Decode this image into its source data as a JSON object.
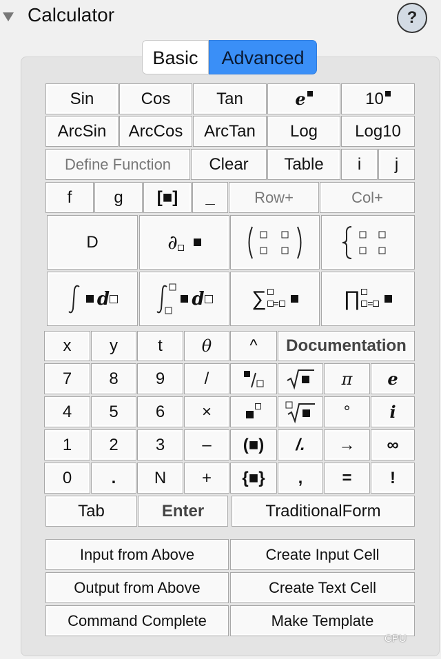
{
  "header": {
    "title": "Calculator",
    "help_label": "?"
  },
  "tabs": {
    "basic": "Basic",
    "advanced": "Advanced"
  },
  "trig": {
    "sin": "Sin",
    "cos": "Cos",
    "tan": "Tan",
    "exp_base": "e",
    "pow10_base": "10",
    "arcsin": "ArcSin",
    "arccos": "ArcCos",
    "arctan": "ArcTan",
    "log": "Log",
    "log10": "Log10"
  },
  "row3": {
    "define_function": "Define Function",
    "clear": "Clear",
    "table": "Table",
    "i": "i",
    "j": "j"
  },
  "row4": {
    "f": "f",
    "g": "g",
    "list": "[■]",
    "underscore": "_",
    "row_plus": "Row+",
    "col_plus": "Col+"
  },
  "calculus": {
    "d": "D",
    "partial_symbol": "∂",
    "integral_d": "d",
    "definite_d": "d",
    "sum_symbol": "∑",
    "sum_eq": "=",
    "prod_symbol": "∏",
    "prod_eq": "="
  },
  "vars": {
    "x": "x",
    "y": "y",
    "t": "t",
    "theta": "θ",
    "caret": "^",
    "documentation": "Documentation"
  },
  "keypad": {
    "seven": "7",
    "eight": "8",
    "nine": "9",
    "slash": "/",
    "pi": "π",
    "e": "e",
    "four": "4",
    "five": "5",
    "six": "6",
    "times": "×",
    "degree": "°",
    "imag": "i",
    "one": "1",
    "two": "2",
    "three": "3",
    "minus": "–",
    "paren": "(■)",
    "map": "/.",
    "arrow": "→",
    "infinity": "∞",
    "zero": "0",
    "dot": ".",
    "n": "N",
    "plus": "+",
    "braces": "{■}",
    "comma": ",",
    "equals": "=",
    "bang": "!"
  },
  "bottom": {
    "tab": "Tab",
    "enter": "Enter",
    "traditional_form": "TraditionalForm",
    "input_from_above": "Input from Above",
    "create_input_cell": "Create Input Cell",
    "output_from_above": "Output from Above",
    "create_text_cell": "Create Text Cell",
    "command_complete": "Command Complete",
    "make_template": "Make Template"
  },
  "watermark": "CPU",
  "colors": {
    "accent": "#3a8ff7",
    "panel": "#e4e4e4",
    "button": "#f9f9f9"
  }
}
